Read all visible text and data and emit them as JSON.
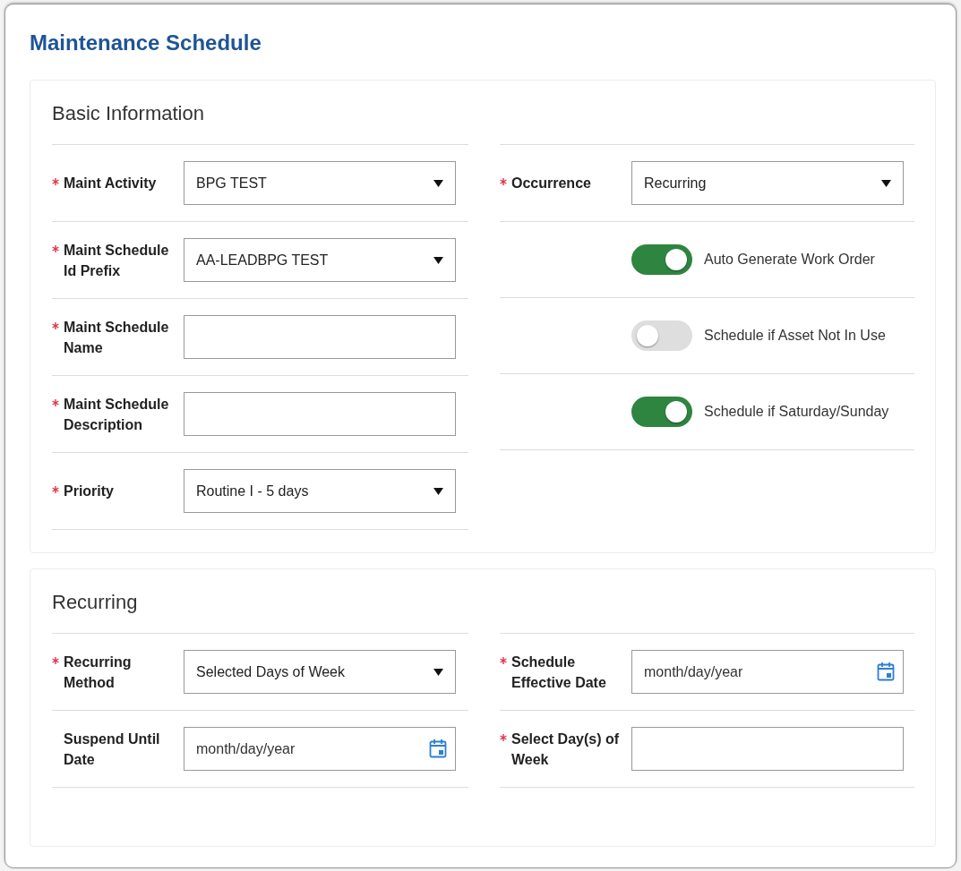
{
  "title": "Maintenance Schedule",
  "sections": [
    {
      "title": "Basic Information",
      "columns": [
        [
          {
            "kind": "select",
            "label": "Maint Activity",
            "required": true,
            "value": "BPG TEST"
          },
          {
            "kind": "select",
            "label": "Maint Schedule Id Prefix",
            "required": true,
            "value": "AA-LEADBPG TEST"
          },
          {
            "kind": "text",
            "label": "Maint Schedule Name",
            "required": true
          },
          {
            "kind": "text",
            "label": "Maint Schedule Description",
            "required": true
          },
          {
            "kind": "select",
            "label": "Priority",
            "required": true,
            "value": "Routine I - 5 days"
          }
        ],
        [
          {
            "kind": "select",
            "label": "Occurrence",
            "required": true,
            "value": "Recurring"
          },
          {
            "kind": "toggle",
            "label": "Auto Generate Work Order",
            "on": true
          },
          {
            "kind": "toggle",
            "label": "Schedule if Asset Not In Use",
            "on": false
          },
          {
            "kind": "toggle",
            "label": "Schedule if Saturday/Sunday",
            "on": true
          }
        ]
      ]
    },
    {
      "title": "Recurring",
      "columns": [
        [
          {
            "kind": "select",
            "label": "Recurring Method",
            "required": true,
            "value": "Selected Days of Week"
          },
          {
            "kind": "date",
            "label": "Suspend Until Date",
            "required": false,
            "placeholder": "month/day/year"
          }
        ],
        [
          {
            "kind": "date",
            "label": "Schedule Effective Date",
            "required": true,
            "placeholder": "month/day/year"
          },
          {
            "kind": "text",
            "label": "Select Day(s) of Week",
            "required": true
          }
        ]
      ]
    }
  ]
}
